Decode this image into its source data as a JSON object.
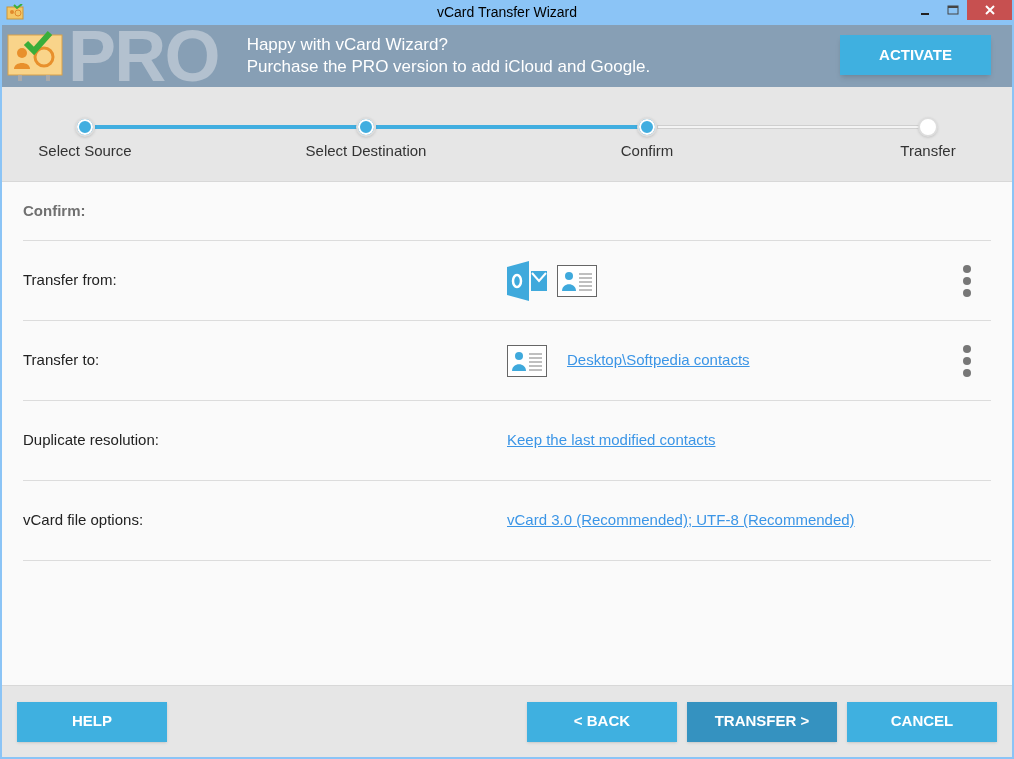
{
  "window": {
    "title": "vCard Transfer Wizard"
  },
  "banner": {
    "logo_text": "PRO",
    "lines": [
      "Happy with vCard Wizard?",
      "Purchase the PRO version to add iCloud and Google."
    ],
    "button": "ACTIVATE"
  },
  "steps": [
    {
      "label": "Select Source",
      "completed": true
    },
    {
      "label": "Select Destination",
      "completed": true
    },
    {
      "label": "Confirm",
      "completed": true
    },
    {
      "label": "Transfer",
      "completed": false
    }
  ],
  "section_title": "Confirm:",
  "rows": [
    {
      "kind": "source",
      "label": "Transfer from:",
      "menu": true
    },
    {
      "kind": "destination",
      "label": "Transfer to:",
      "link": "Desktop\\Softpedia contacts",
      "menu": true
    },
    {
      "kind": "link",
      "label": "Duplicate resolution:",
      "link": "Keep the last modified contacts",
      "menu": false
    },
    {
      "kind": "link",
      "label": "vCard file options:",
      "link": "vCard 3.0 (Recommended); UTF-8 (Recommended)",
      "menu": false
    }
  ],
  "buttons": [
    {
      "label": "HELP",
      "primary": false
    },
    {
      "label": "< BACK",
      "primary": false
    },
    {
      "label": "TRANSFER >",
      "primary": true
    },
    {
      "label": "CANCEL",
      "primary": false
    }
  ]
}
